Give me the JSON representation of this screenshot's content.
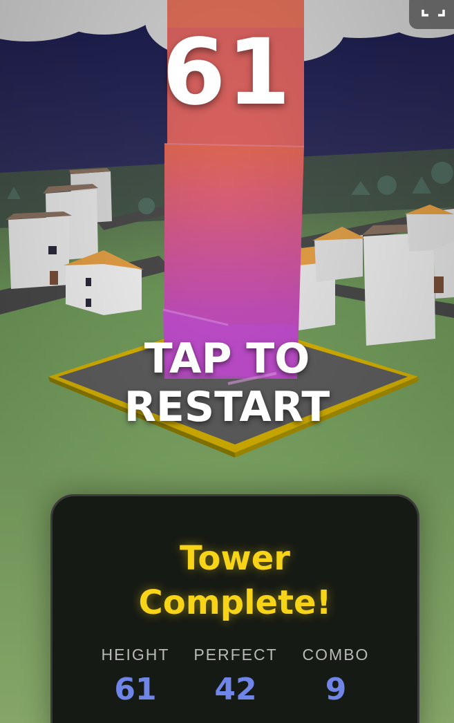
{
  "hud": {
    "score": "61",
    "restart_line1": "TAP TO",
    "restart_line2": "RESTART"
  },
  "panel": {
    "title_line1": "Tower",
    "title_line2": "Complete!",
    "stats": [
      {
        "label": "HEIGHT",
        "value": "61"
      },
      {
        "label": "PERFECT",
        "value": "42"
      },
      {
        "label": "COMBO",
        "value": "9"
      }
    ]
  },
  "icons": {
    "fullscreen": "fullscreen-icon"
  },
  "colors": {
    "title_yellow": "#f7d418",
    "stat_blue": "#6f86e8",
    "tower_top": "#d9605a",
    "tower_bottom": "#c24fc6",
    "platform_border": "#d9b400"
  }
}
